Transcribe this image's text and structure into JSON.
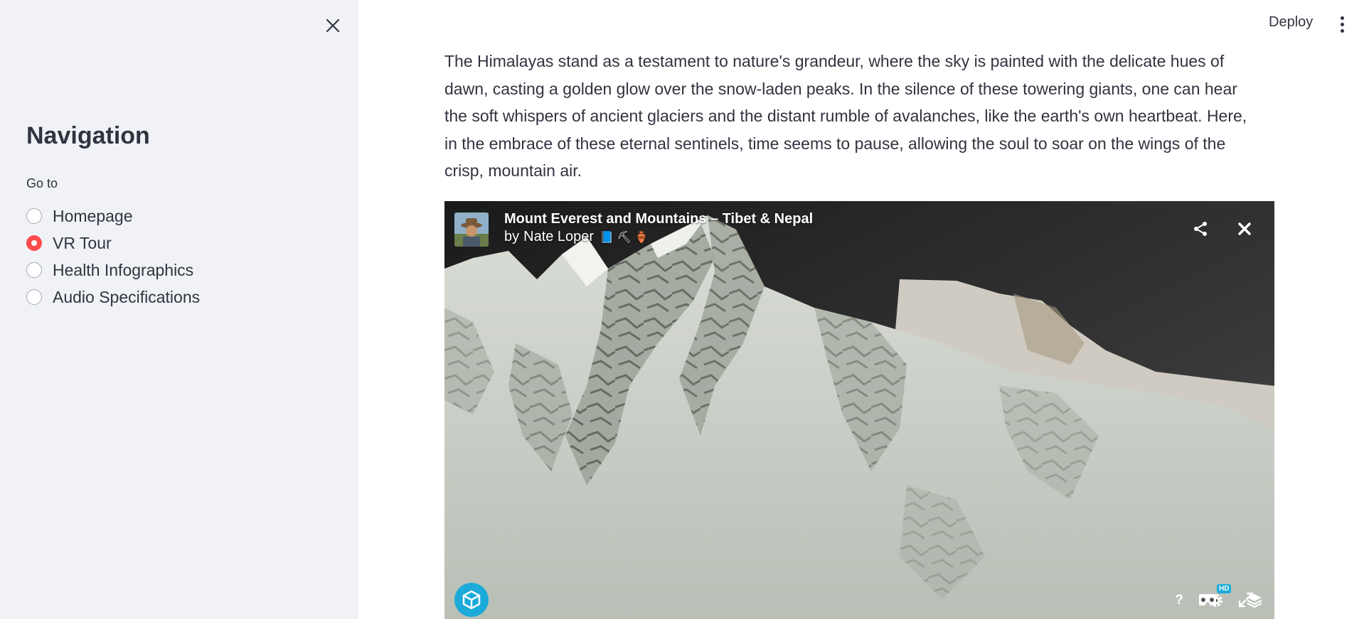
{
  "sidebar": {
    "title": "Navigation",
    "radio_label": "Go to",
    "options": [
      {
        "label": "Homepage",
        "selected": false
      },
      {
        "label": "VR Tour",
        "selected": true
      },
      {
        "label": "Health Infographics",
        "selected": false
      },
      {
        "label": "Audio Specifications",
        "selected": false
      }
    ],
    "close_icon": "close-icon"
  },
  "header": {
    "deploy_label": "Deploy",
    "menu_icon": "kebab-menu-icon"
  },
  "main": {
    "intro_text": "The Himalayas stand as a testament to nature's grandeur, where the sky is painted with the delicate hues of dawn, casting a golden glow over the snow-laden peaks. In the silence of these towering giants, one can hear the soft whispers of ancient glaciers and the distant rumble of avalanches, like the earth's own heartbeat. Here, in the embrace of these eternal sentinels, time seems to pause, allowing the soul to soar on the wings of the crisp, mountain air."
  },
  "viewer": {
    "title": "Mount Everest and Mountains – Tibet & Nepal",
    "author_prefix": "by",
    "author_name": "Nate Loper",
    "author_badges": "📘 ⛏ 🏺",
    "hd_badge": "HD",
    "help_label": "?",
    "icons": [
      "share-icon",
      "close-icon",
      "sketchfab-logo-icon",
      "help-icon",
      "settings-icon",
      "layers-icon",
      "vr-icon",
      "fullscreen-icon"
    ],
    "accent_color": "#1caad9"
  },
  "colors": {
    "sidebar_bg": "#f0f2f6",
    "radio_selected": "#ff4b4b",
    "text": "#31333f"
  }
}
